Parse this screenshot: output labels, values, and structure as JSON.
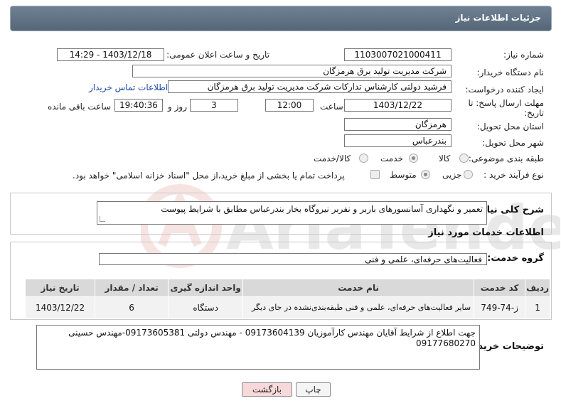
{
  "header": {
    "title": "جزئیات اطلاعات نیاز"
  },
  "fields": {
    "need_number_label": "شماره نیاز:",
    "need_number": "1103007021000411",
    "announce_label": "تاریخ و ساعت اعلان عمومی:",
    "announce_value": "1403/12/18 - 14:29",
    "buyer_org_label": "نام دستگاه خریدار:",
    "buyer_org": "شرکت مدیریت تولید برق هرمزگان",
    "creator_label": "ایجاد کننده درخواست:",
    "creator": "فرشید دولتی کارشناس تدارکات شرکت مدیریت تولید برق هرمزگان",
    "contact_link": "اطلاعات تماس خریدار",
    "deadline_label_1": "مهلت ارسال پاسخ: تا",
    "deadline_label_2": "تاریخ:",
    "deadline_date": "1403/12/22",
    "time_label": "ساعت",
    "deadline_time": "12:00",
    "days_value": "3",
    "days_label": "روز و",
    "remaining_time": "19:40:36",
    "remaining_label": "ساعت باقی مانده",
    "province_label": "استان محل تحویل:",
    "province": "هرمزگان",
    "city_label": "شهر محل تحویل:",
    "city": "بندرعباس",
    "category_label": "طبقه بندی موضوعی:",
    "category_options": [
      "کالا",
      "خدمت",
      "کالا/خدمت"
    ],
    "process_label": "نوع فرآیند خرید :",
    "process_options": [
      "جزیی",
      "متوسط"
    ],
    "payment_note": "پرداخت تمام یا بخشی از مبلغ خرید،از محل \"اسناد خزانه اسلامی\" خواهد بود."
  },
  "summary": {
    "label": "شرح کلی نیاز:",
    "text": "تعمیر و نگهداری آسانسورهای باربر  و  نفربر  نیروگاه بخار بندرعباس مطابق با شرایط پیوست"
  },
  "services": {
    "section_title": "اطلاعات خدمات مورد نیاز",
    "group_label": "گروه خدمت:",
    "group_value": "فعالیت‌های حرفه‌ای، علمی و فنی",
    "columns": [
      "ردیف",
      "کد خدمت",
      "نام خدمت",
      "واحد اندازه گیری",
      "تعداد / مقدار",
      "تاریخ نیاز"
    ],
    "rows": [
      {
        "row": "1",
        "code": "ز-74-749",
        "name": "سایر فعالیت‌های حرفه‌ای، علمی و فنی طبقه‌بندی‌نشده در جای دیگر",
        "unit": "دستگاه",
        "qty": "6",
        "date": "1403/12/22"
      }
    ]
  },
  "buyer_notes": {
    "label": "توضیحات خریدار:",
    "text": "جهت اطلاع از شرایط آقایان مهندس کارآموزیان 09173604139 - مهندس دولتی 09173605381-مهندس حسینی 09177680270"
  },
  "buttons": {
    "print": "چاپ",
    "back": "بازگشت"
  },
  "watermark": {
    "text": "AriaTender.neT"
  },
  "colors": {
    "header_bg": "#607080",
    "link": "#1a4aa8",
    "back_button": "#f7d9d9"
  }
}
